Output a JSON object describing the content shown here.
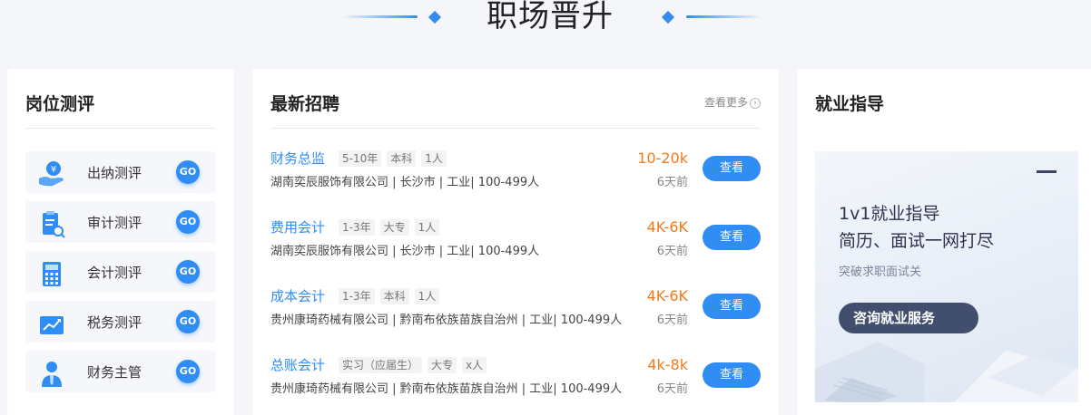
{
  "banner": {
    "title": "职场晋升"
  },
  "left_card": {
    "title": "岗位测评",
    "go_label": "GO",
    "items": [
      {
        "label": "出纳测评",
        "icon": "cashier-icon"
      },
      {
        "label": "审计测评",
        "icon": "audit-icon"
      },
      {
        "label": "会计测评",
        "icon": "calculator-icon"
      },
      {
        "label": "税务测评",
        "icon": "tax-chart-icon"
      },
      {
        "label": "财务主管",
        "icon": "manager-icon"
      }
    ]
  },
  "mid_card": {
    "title": "最新招聘",
    "more_label": "查看更多",
    "view_label": "查看",
    "jobs": [
      {
        "name": "财务总监",
        "tags": [
          "5-10年",
          "本科",
          "1人"
        ],
        "company": "湖南奕辰服饰有限公司 | 长沙市 | 工业| 100-499人",
        "salary": "10-20k",
        "time": "6天前"
      },
      {
        "name": "费用会计",
        "tags": [
          "1-3年",
          "大专",
          "1人"
        ],
        "company": "湖南奕辰服饰有限公司 | 长沙市 | 工业| 100-499人",
        "salary": "4K-6K",
        "time": "6天前"
      },
      {
        "name": "成本会计",
        "tags": [
          "1-3年",
          "本科",
          "1人"
        ],
        "company": "贵州康琦药械有限公司 | 黔南布依族苗族自治州 | 工业| 100-499人",
        "salary": "4K-6K",
        "time": "6天前"
      },
      {
        "name": "总账会计",
        "tags": [
          "实习（应届生）",
          "大专",
          "x人"
        ],
        "company": "贵州康琦药械有限公司 | 黔南布依族苗族自治州 | 工业| 100-499人",
        "salary": "4k-8k",
        "time": "6天前"
      }
    ]
  },
  "right_card": {
    "title": "就业指导",
    "headline_1": "1v1就业指导",
    "headline_2": "简历、面试一网打尽",
    "subtitle": "突破求职面试关",
    "button_label": "咨询就业服务"
  },
  "colors": {
    "accent": "#2f8df3",
    "salary": "#f27a1a",
    "button_dark": "#424e6e"
  }
}
